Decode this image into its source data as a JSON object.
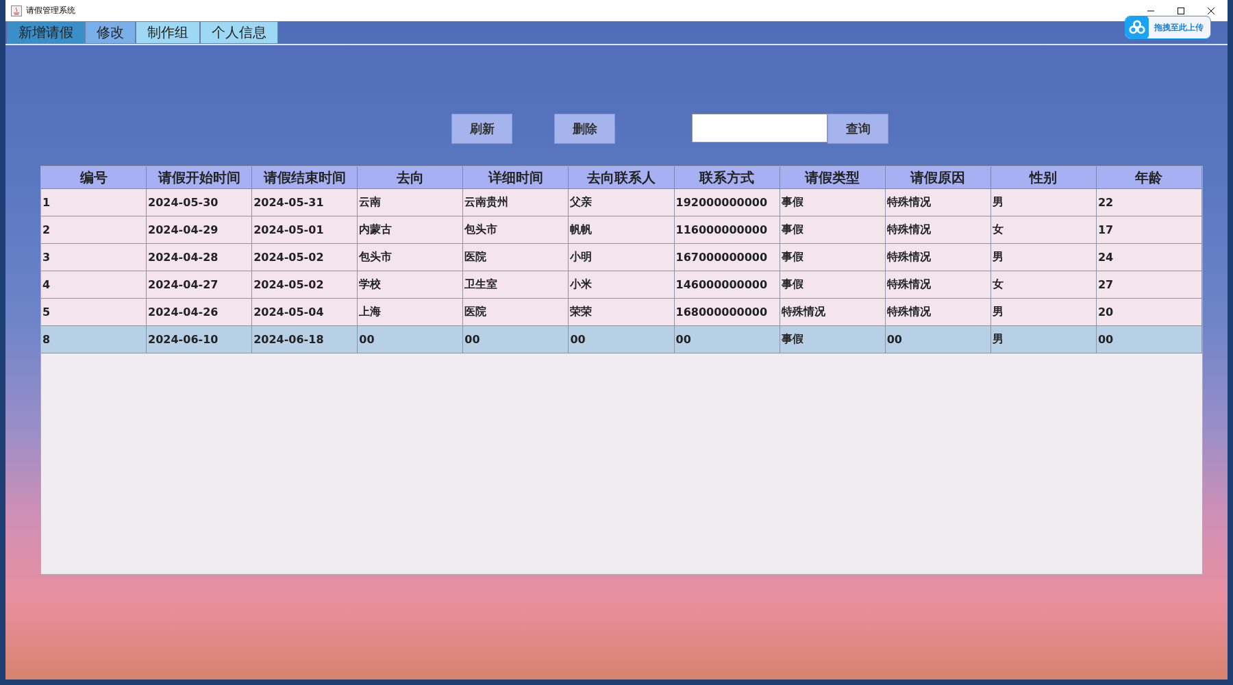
{
  "window": {
    "title": "请假管理系统"
  },
  "menu": [
    {
      "label": "新增请假",
      "selected": true,
      "hovered": false
    },
    {
      "label": "修改",
      "selected": false,
      "hovered": true
    },
    {
      "label": "制作组",
      "selected": false,
      "hovered": false
    },
    {
      "label": "个人信息",
      "selected": false,
      "hovered": false
    }
  ],
  "upload_widget": {
    "label": "拖拽至此上传"
  },
  "toolbar": {
    "buttons": [
      "刷新",
      "删除"
    ],
    "search_button": "查询"
  },
  "table": {
    "columns": [
      "编号",
      "请假开始时间",
      "请假结束时间",
      "去向",
      "详细时间",
      "去向联系人",
      "联系方式",
      "请假类型",
      "请假原因",
      "性别",
      "年龄"
    ],
    "rows": [
      {
        "selected": false,
        "cells": [
          "1",
          "2024-05-30",
          "2024-05-31",
          "云南",
          "云南贵州",
          "父亲",
          "192000000000",
          "事假",
          "特殊情况",
          "男",
          "22"
        ]
      },
      {
        "selected": false,
        "cells": [
          "2",
          "2024-04-29",
          "2024-05-01",
          "内蒙古",
          "包头市",
          "帆帆",
          "116000000000",
          "事假",
          "特殊情况",
          "女",
          "17"
        ]
      },
      {
        "selected": false,
        "cells": [
          "3",
          "2024-04-28",
          "2024-05-02",
          "包头市",
          "医院",
          "小明",
          "167000000000",
          "事假",
          "特殊情况",
          "男",
          "24"
        ]
      },
      {
        "selected": false,
        "cells": [
          "4",
          "2024-04-27",
          "2024-05-02",
          "学校",
          "卫生室",
          "小米",
          "146000000000",
          "事假",
          "特殊情况",
          "女",
          "27"
        ]
      },
      {
        "selected": false,
        "cells": [
          "5",
          "2024-04-26",
          "2024-05-04",
          "上海",
          "医院",
          "荣荣",
          "168000000000",
          "特殊情况",
          "特殊情况",
          "男",
          "20"
        ]
      },
      {
        "selected": true,
        "cells": [
          "8",
          "2024-06-10",
          "2024-06-18",
          "00",
          "00",
          "00",
          "00",
          "事假",
          "00",
          "男",
          "00"
        ]
      }
    ]
  }
}
